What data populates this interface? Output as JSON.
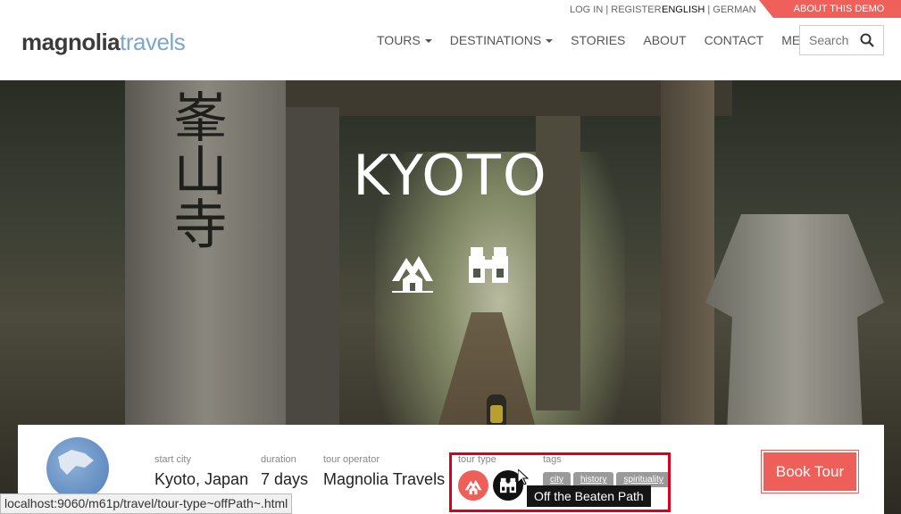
{
  "topbar": {
    "login": "LOG IN",
    "separator": " | ",
    "register": "REGISTER",
    "lang_active": "ENGLISH",
    "lang_other": "GERMAN",
    "demo": "ABOUT THIS DEMO"
  },
  "logo": {
    "part1": "magnolia",
    "part2": "travels"
  },
  "nav": {
    "items": [
      "TOURS",
      "DESTINATIONS",
      "STORIES",
      "ABOUT",
      "CONTACT",
      "MEMBERS"
    ]
  },
  "search": {
    "placeholder": "Search"
  },
  "hero": {
    "title": "KYOTO",
    "kanji": "峯山寺"
  },
  "card": {
    "start_city": {
      "label": "start city",
      "value": "Kyoto, Japan"
    },
    "duration": {
      "label": "duration",
      "value": "7 days"
    },
    "operator": {
      "label": "tour operator",
      "value": "Magnolia Travels"
    },
    "tour_type": {
      "label": "tour type"
    },
    "tags": {
      "label": "tags",
      "items": [
        "city",
        "history",
        "spirituality"
      ]
    },
    "book_label": "Book Tour"
  },
  "tooltip": "Off the Beaten Path",
  "status_url": "localhost:9060/m61p/travel/tour-type~offPath~.html",
  "colors": {
    "accent": "#ef5f59",
    "logo_blue": "#7ba7c9",
    "highlight": "#d8001c"
  },
  "icons": [
    "house-mountain-icon",
    "binoculars-icon",
    "search-icon"
  ]
}
